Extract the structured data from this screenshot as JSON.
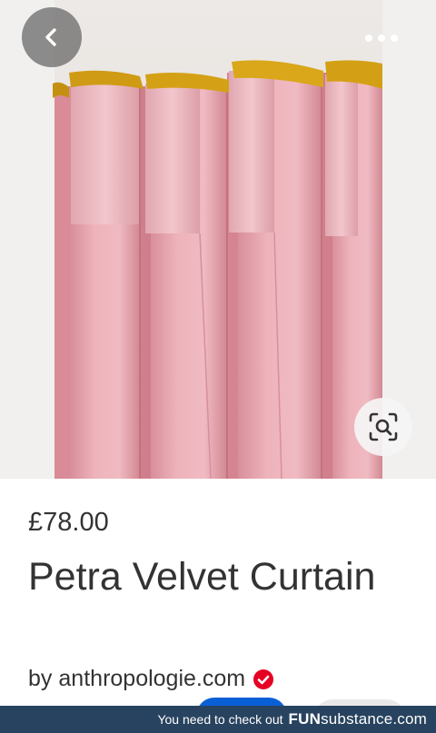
{
  "product": {
    "price": "£78.00",
    "title": "Petra Velvet Curtain",
    "by_prefix": "by",
    "source": "anthropologie.com"
  },
  "icons": {
    "back": "chevron-left-icon",
    "more": "more-horizontal-icon",
    "lens": "visual-search-icon",
    "verified": "verified-check-icon"
  },
  "colors": {
    "curtain_pink": "#e8a3ad",
    "header_gold": "#d4a116",
    "verified_red": "#e60023",
    "primary_button": "#0b5fd6",
    "watermark_bar": "#28435f"
  },
  "watermark": {
    "text": "You need to check out",
    "brand_fun": "FUN",
    "brand_rest": "substance.com"
  }
}
